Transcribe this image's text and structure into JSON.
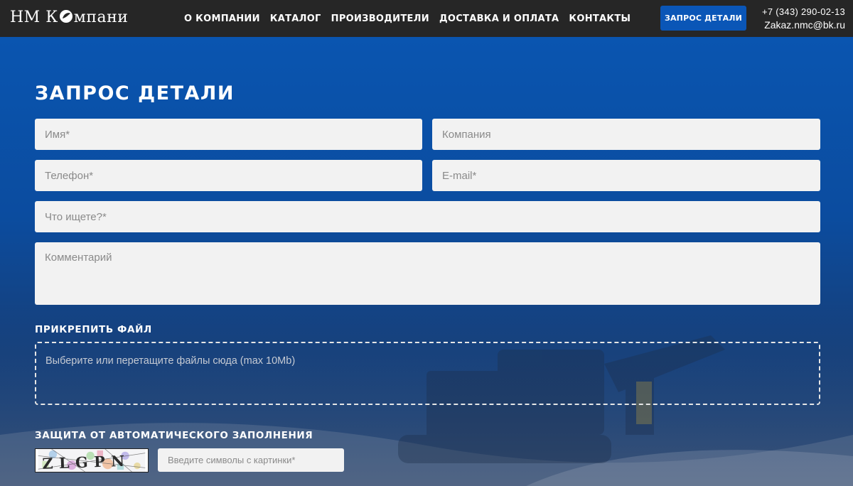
{
  "header": {
    "logo_text_start": "НМ К",
    "logo_text_end": "мпани",
    "nav": [
      "О КОМПАНИИ",
      "КАТАЛОГ",
      "ПРОИЗВОДИТЕЛИ",
      "ДОСТАВКА И ОПЛАТА",
      "КОНТАКТЫ"
    ],
    "request_button": "ЗАПРОС ДЕТАЛИ",
    "phone": "+7 (343) 290-02-13",
    "email": "Zakaz.nmc@bk.ru"
  },
  "form": {
    "title": "ЗАПРОС ДЕТАЛИ",
    "name_placeholder": "Имя*",
    "company_placeholder": "Компания",
    "phone_placeholder": "Телефон*",
    "email_placeholder": "E-mail*",
    "query_placeholder": "Что ищете?*",
    "comment_placeholder": "Комментарий",
    "attach_label": "ПРИКРЕПИТЬ ФАЙЛ",
    "dropzone_text": "Выберите или перетащите файлы сюда (max 10Mb)",
    "captcha_label": "ЗАЩИТА ОТ АВТОМАТИЧЕСКОГО ЗАПОЛНЕНИЯ",
    "captcha_placeholder": "Введите символы с картинки*",
    "captcha_text": "ZLGPN"
  },
  "colors": {
    "header_bg": "#262626",
    "accent": "#0a56b7",
    "field_bg": "#f2f2f2"
  }
}
